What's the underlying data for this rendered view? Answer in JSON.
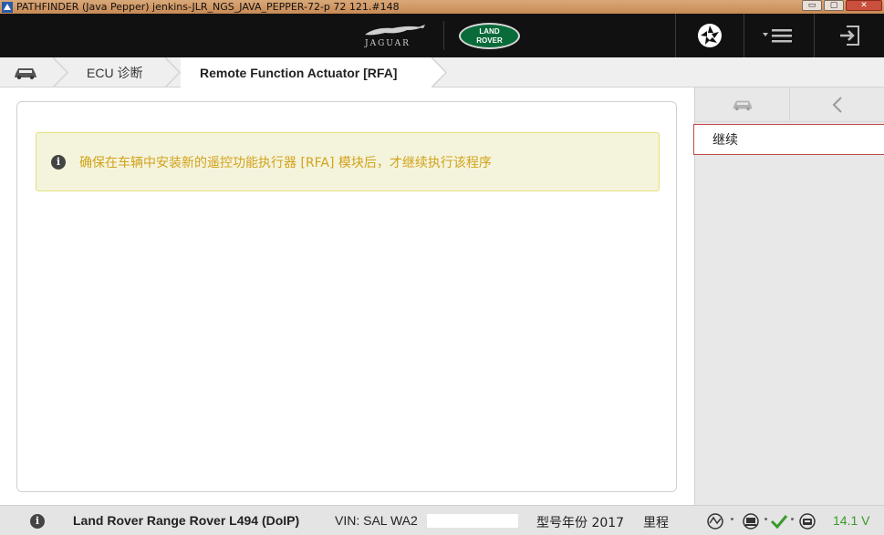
{
  "window": {
    "title": "PATHFINDER (Java Pepper) jenkins-JLR_NGS_JAVA_PEPPER-72-p 72 121.#148",
    "minimize_glyph": "▭",
    "maximize_glyph": "▢",
    "close_glyph": "✕"
  },
  "header": {
    "jaguar_wordmark": "JAGUAR",
    "landrover_line1": "LAND",
    "landrover_line2": "ROVER",
    "icons": [
      "shutter-icon",
      "menu-icon",
      "exit-icon"
    ]
  },
  "breadcrumb": {
    "items": [
      {
        "icon": "car-icon"
      },
      {
        "label": "ECU 诊断"
      },
      {
        "label": "Remote Function Actuator [RFA]"
      }
    ]
  },
  "main": {
    "notice": {
      "icon": "info-icon",
      "text": "确保在车辆中安装新的遥控功能执行器 [RFA] 模块后，才继续执行该程序",
      "text_color": "#d2a21b",
      "background": "#f4f4dc"
    }
  },
  "sidebar": {
    "icons": [
      "car-icon",
      "back-arrow-icon"
    ],
    "continue_label": "继续"
  },
  "status": {
    "vehicle": "Land Rover Range Rover L494 (DoIP)",
    "vin": "VIN: SAL WA2",
    "model_year": "型号年份 2017",
    "mileage_label": "里程",
    "voltage": "14.1 V",
    "voltage_color": "#3a9a2a",
    "icons": [
      "info-icon",
      "connection-icon",
      "laptop-icon",
      "check-icon",
      "vci-icon"
    ]
  },
  "colors": {
    "header_bg": "#111111",
    "accent_border": "#c24848"
  }
}
